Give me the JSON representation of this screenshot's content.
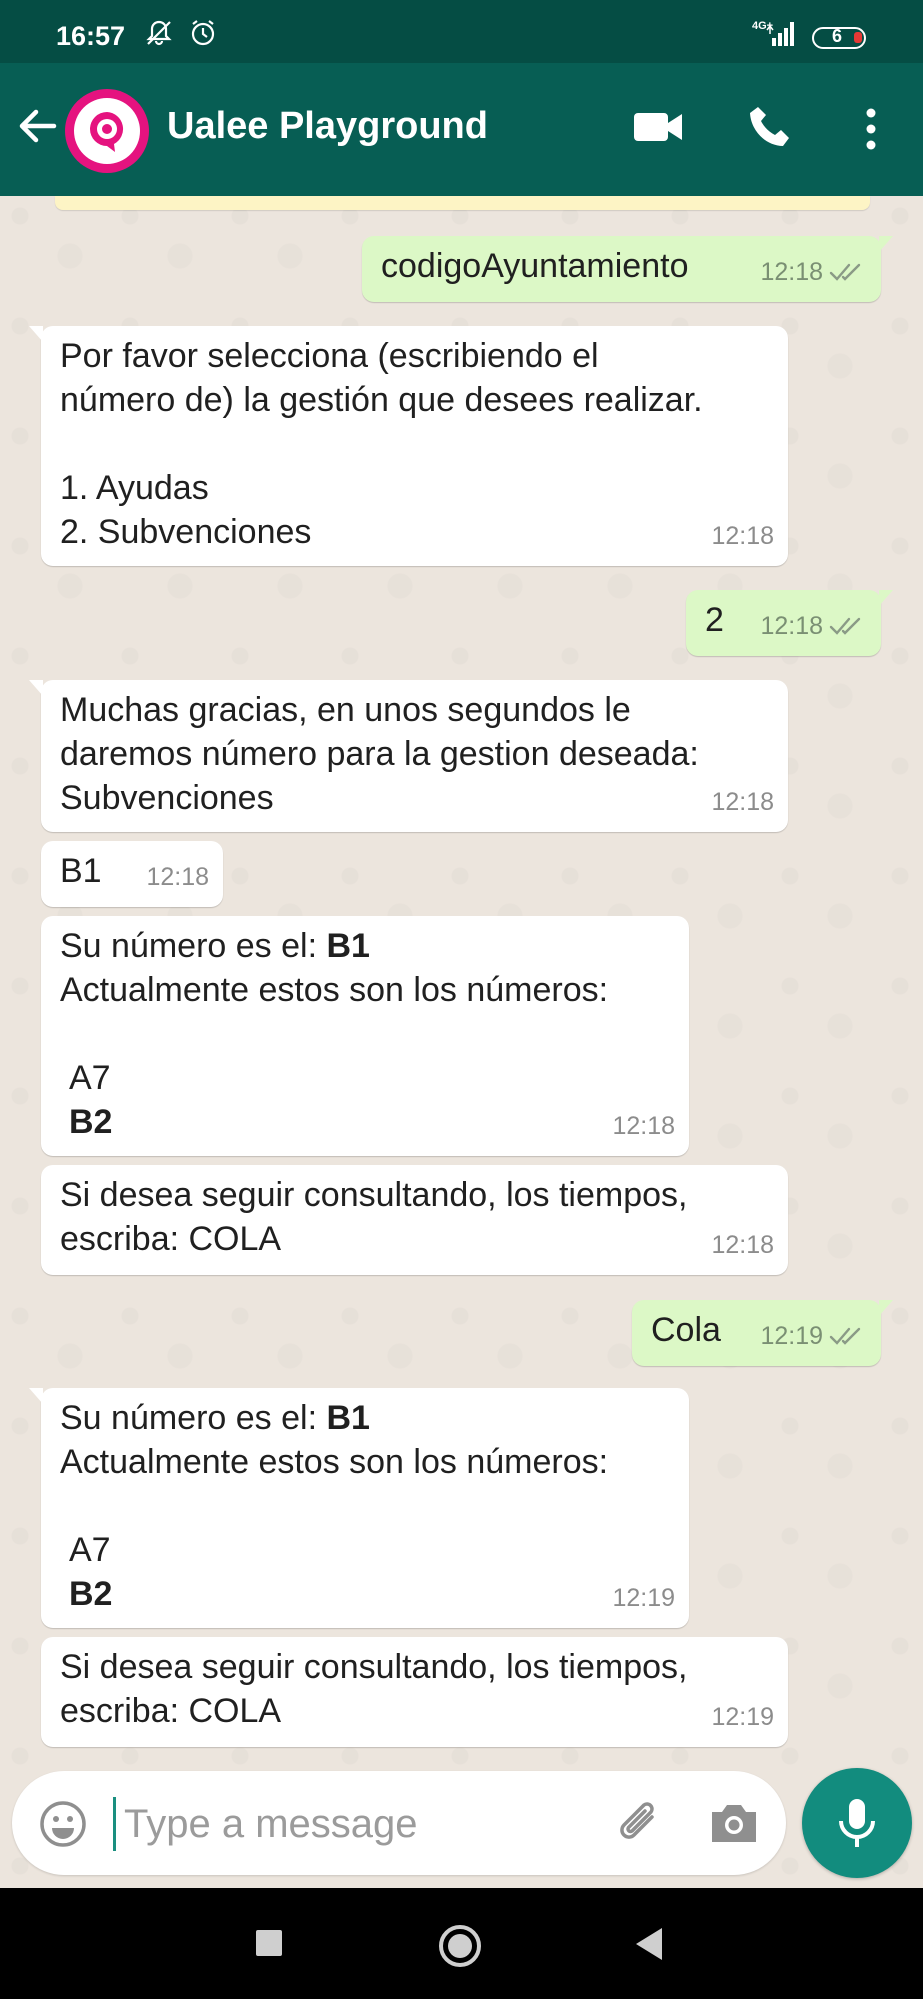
{
  "status": {
    "time": "16:57",
    "network": "4G+",
    "battery": "6"
  },
  "header": {
    "title": "Ualee Playground"
  },
  "messages": [
    {
      "dir": "out",
      "text": "codigoAyuntamiento",
      "time": "12:18",
      "read": true
    },
    {
      "dir": "in",
      "lines": [
        "Por favor selecciona (escribiendo el",
        "número de) la gestión que desees realizar.",
        "",
        "1. Ayudas",
        "2. Subvenciones"
      ],
      "time": "12:18"
    },
    {
      "dir": "out",
      "text": "2",
      "time": "12:18",
      "read": true
    },
    {
      "dir": "in",
      "lines": [
        "Muchas gracias, en unos segundos le",
        "daremos número para la gestion deseada:",
        "Subvenciones"
      ],
      "time": "12:18"
    },
    {
      "dir": "in",
      "text": "B1",
      "time": "12:18"
    },
    {
      "dir": "in",
      "prefix": "Su número es el: ",
      "number": "B1",
      "line2": "Actualmente estos son los números:",
      "list_item": "A7",
      "list_item_bold": "B2",
      "time": "12:18"
    },
    {
      "dir": "in",
      "lines": [
        "Si desea seguir consultando, los tiempos,",
        "escriba: COLA"
      ],
      "time": "12:18"
    },
    {
      "dir": "out",
      "text": "Cola",
      "time": "12:19",
      "read": true
    },
    {
      "dir": "in",
      "prefix": "Su número es el: ",
      "number": "B1",
      "line2": "Actualmente estos son los números:",
      "list_item": "A7",
      "list_item_bold": "B2",
      "time": "12:19"
    },
    {
      "dir": "in",
      "lines": [
        "Si desea seguir consultando, los tiempos,",
        "escriba: COLA"
      ],
      "time": "12:19"
    }
  ],
  "composer": {
    "placeholder": "Type a message"
  },
  "colors": {
    "header": "#075e54",
    "statusbar": "#054d44",
    "outgoing": "#dcf8c6",
    "incoming": "#ffffff",
    "accent": "#128c7e",
    "avatar": "#e5137f"
  },
  "icons": [
    "back-arrow-icon",
    "video-call-icon",
    "phone-icon",
    "more-options-icon",
    "emoji-icon",
    "attach-icon",
    "camera-icon",
    "mic-icon",
    "read-ticks-icon"
  ]
}
